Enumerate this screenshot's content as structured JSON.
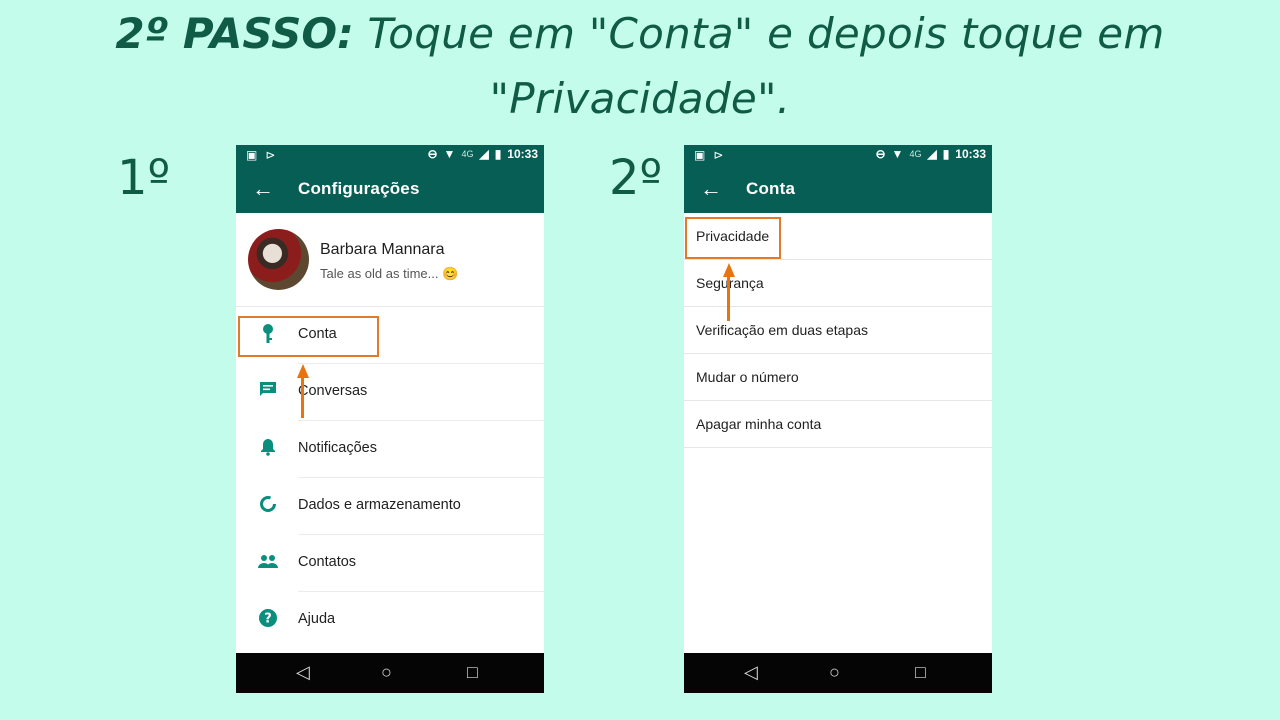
{
  "heading": {
    "bold": "2º PASSO:",
    "line1": " Toque em \"Conta\" e depois toque em",
    "line2": "\"Privacidade\"."
  },
  "steps": [
    "1º",
    "2º"
  ],
  "status_bar": {
    "gauge_4g": "4G",
    "time": "10:33"
  },
  "screen1": {
    "title": "Configurações",
    "profile": {
      "name": "Barbara Mannara",
      "status": "Tale as old as time... 😊"
    },
    "items": [
      {
        "label": "Conta",
        "icon": "key-icon"
      },
      {
        "label": "Conversas",
        "icon": "chat-icon"
      },
      {
        "label": "Notificações",
        "icon": "bell-icon"
      },
      {
        "label": "Dados e armazenamento",
        "icon": "data-usage-icon"
      },
      {
        "label": "Contatos",
        "icon": "people-icon"
      },
      {
        "label": "Ajuda",
        "icon": "help-icon"
      }
    ]
  },
  "screen2": {
    "title": "Conta",
    "items": [
      {
        "label": "Privacidade"
      },
      {
        "label": "Segurança"
      },
      {
        "label": "Verificação em duas etapas"
      },
      {
        "label": "Mudar o número"
      },
      {
        "label": "Apagar minha conta"
      }
    ]
  },
  "colors": {
    "background": "#c4fcec",
    "toolbar": "#075e54",
    "accent": "#0a8f7e",
    "highlight": "#e17a2b"
  }
}
